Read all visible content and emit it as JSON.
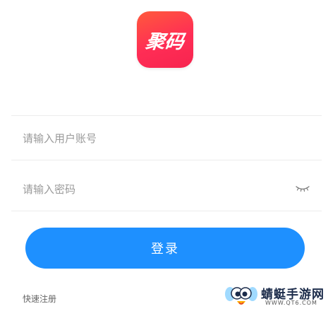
{
  "app": {
    "logo_text": "聚码",
    "brand_gradient": [
      "#ff5a3c",
      "#f7244f"
    ]
  },
  "form": {
    "account_placeholder": "请输入用户账号",
    "password_placeholder": "请输入密码",
    "password_toggle_icon": "eye-closed-icon",
    "login_label": "登录",
    "login_color": "#1e90ff"
  },
  "footer": {
    "register_label": "快速注册"
  },
  "watermark": {
    "title": "蜻蜓手游网",
    "url": "WWW.QT6.COM"
  }
}
